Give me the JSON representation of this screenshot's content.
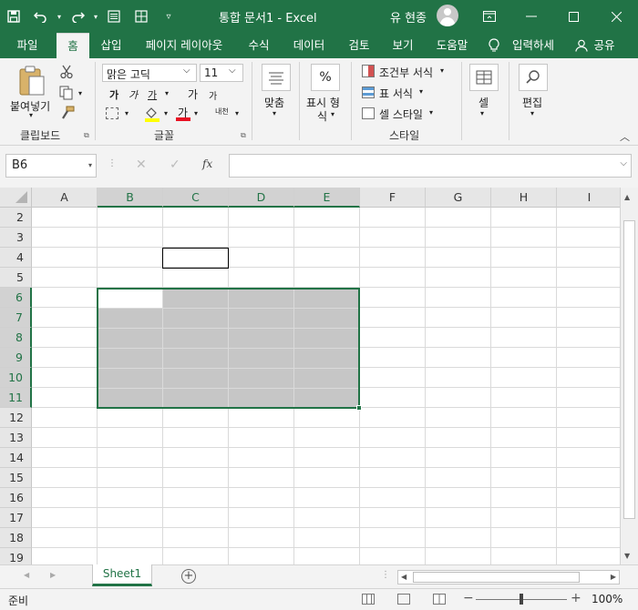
{
  "window": {
    "doc_title": "통합 문서1  -  Excel",
    "user_name": "유 현종"
  },
  "ribbon_tabs": [
    "파일",
    "홈",
    "삽입",
    "페이지 레이아웃",
    "수식",
    "데이터",
    "검토",
    "보기",
    "도움말",
    "입력하세",
    "공유"
  ],
  "ribbon": {
    "clipboard": {
      "paste_label": "붙여넣기",
      "group_label": "클립보드"
    },
    "font": {
      "font_name": "맑은 고딕",
      "font_size": "11",
      "bold": "가",
      "italic": "가",
      "underline": "가",
      "grow": "가",
      "shrink": "가",
      "font_color_glyph": "가",
      "phonetic": "내천",
      "group_label": "글꼴"
    },
    "alignment": {
      "label": "맞춤"
    },
    "number": {
      "symbol": "%",
      "label_line1": "표시 형",
      "label_line2": "식"
    },
    "styles": {
      "conditional": "조건부 서식",
      "table_format": "표 서식",
      "cell_styles": "셀 스타일",
      "group_label": "스타일"
    },
    "cells": {
      "label": "셀"
    },
    "editing": {
      "label": "편집"
    }
  },
  "formula_bar": {
    "name_box": "B6",
    "fx": "fx",
    "value": ""
  },
  "grid": {
    "columns": [
      "A",
      "B",
      "C",
      "D",
      "E",
      "F",
      "G",
      "H",
      "I"
    ],
    "rows": [
      "2",
      "3",
      "4",
      "5",
      "6",
      "7",
      "8",
      "9",
      "10",
      "11",
      "12",
      "13",
      "14",
      "15",
      "16",
      "17",
      "18",
      "19"
    ],
    "selected_columns": [
      "B",
      "C",
      "D",
      "E"
    ],
    "selected_rows": [
      "6",
      "7",
      "8",
      "9",
      "10",
      "11"
    ],
    "active_cell": "B6",
    "selection_range": "B6:E11",
    "outlined_cell": "C4"
  },
  "sheets": {
    "tabs": [
      "Sheet1"
    ],
    "active": "Sheet1"
  },
  "status": {
    "mode": "준비",
    "zoom": "100%"
  },
  "colors": {
    "accent": "#217346",
    "selection_fill": "#c6c6c6",
    "ribbon_bg": "#f3f3f3"
  }
}
